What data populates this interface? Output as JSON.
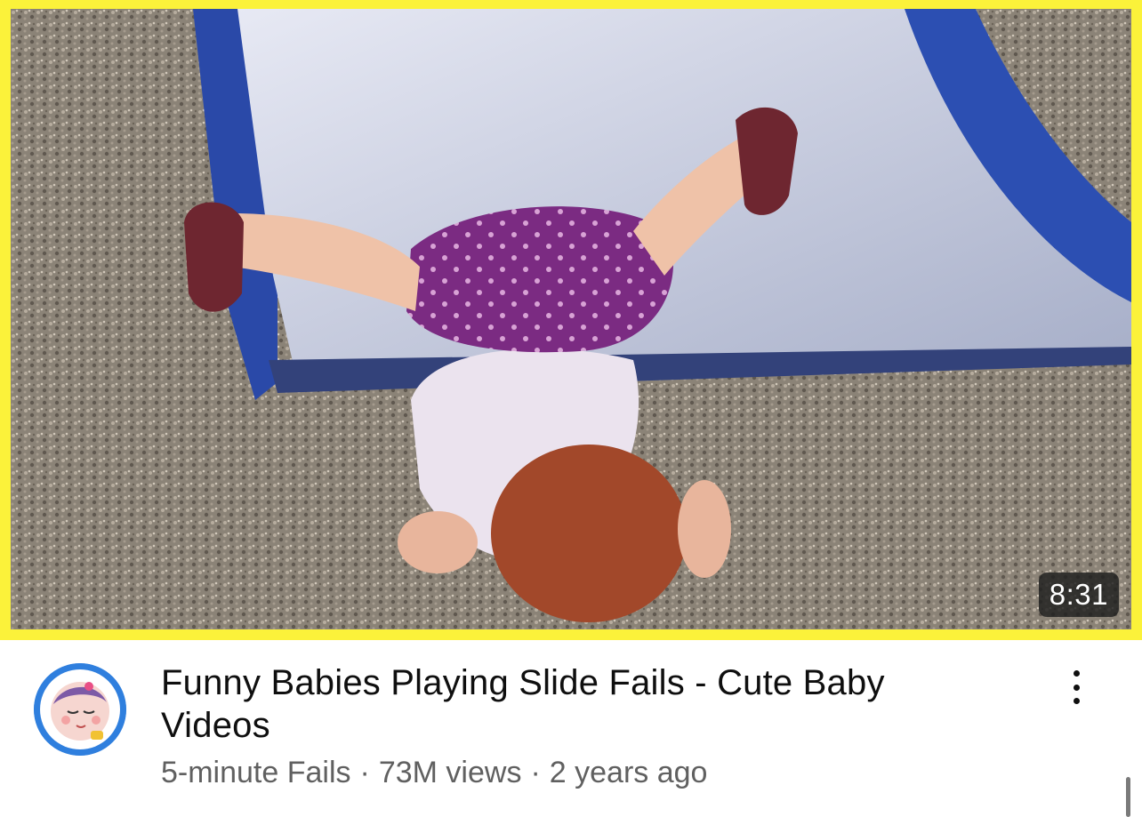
{
  "video": {
    "duration": "8:31",
    "title": "Funny Babies Playing Slide Fails - Cute Baby Videos",
    "channel": "5-minute Fails",
    "views": "73M views",
    "age": "2 years ago",
    "separator": "·"
  },
  "icons": {
    "menu": "more-vertical-icon",
    "avatar": "baby-face-avatar"
  },
  "colors": {
    "thumbnail_border": "#fbf23a",
    "avatar_ring": "#2f7fde",
    "title_text": "#0f0f0f",
    "meta_text": "#606060"
  }
}
